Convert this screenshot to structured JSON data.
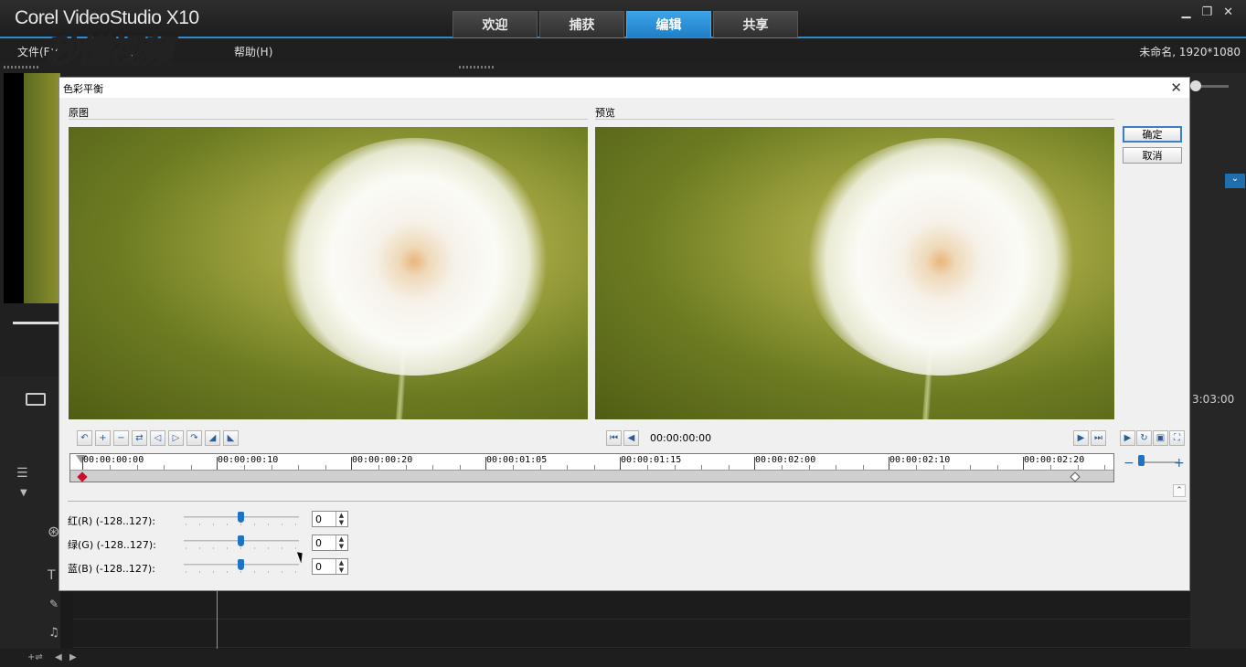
{
  "app": {
    "title": "Corel VideoStudio X10",
    "tabs": [
      {
        "label": "欢迎",
        "active": false
      },
      {
        "label": "捕获",
        "active": false
      },
      {
        "label": "编辑",
        "active": true
      },
      {
        "label": "共享",
        "active": false
      }
    ],
    "menu": {
      "file": "文件(F)",
      "help": "帮助(H)"
    },
    "project_info": "未命名, 1920*1080",
    "timecode": "3:03:00",
    "watermark": "秒懂视频",
    "accent_color": "#2f8ccd"
  },
  "dialog": {
    "title": "色彩平衡",
    "original_label": "原图",
    "preview_label": "预览",
    "ok_label": "确定",
    "cancel_label": "取消",
    "current_time": "00:00:00:00",
    "ruler_ticks": [
      "00:00:00:00",
      "00:00:00:10",
      "00:00:00:20",
      "00:00:01:05",
      "00:00:01:15",
      "00:00:02:00",
      "00:00:02:10",
      "00:00:02:20"
    ],
    "controls": [
      {
        "label": "红(R) (-128..127):",
        "value": "0",
        "level": 0
      },
      {
        "label": "绿(G) (-128..127):",
        "value": "0",
        "level": 0
      },
      {
        "label": "蓝(B) (-128..127):",
        "value": "0",
        "level": 0
      }
    ]
  }
}
